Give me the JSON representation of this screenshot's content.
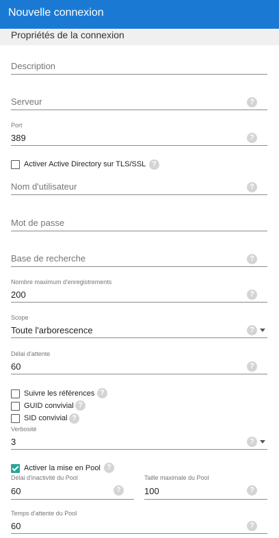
{
  "window": {
    "title": "Nouvelle connexion"
  },
  "section": {
    "title": "Propriétés de la connexion"
  },
  "help_glyph": "?",
  "form": {
    "description": {
      "placeholder": "Description"
    },
    "server": {
      "placeholder": "Serveur"
    },
    "port": {
      "label": "Port",
      "value": "389"
    },
    "ad_tls": {
      "label": "Activer Active Directory sur TLS/SSL",
      "checked": false
    },
    "username": {
      "placeholder": "Nom d'utilisateur"
    },
    "password": {
      "placeholder": "Mot de passe"
    },
    "search_base": {
      "placeholder": "Base de recherche"
    },
    "max_records": {
      "label": "Nombre maximum d'enregistrements",
      "value": "200"
    },
    "scope": {
      "label": "Scope",
      "value": "Toute l'arborescence"
    },
    "timeout": {
      "label": "Délai d'attente",
      "value": "60"
    },
    "follow_refs": {
      "label": "Suivre les références",
      "checked": false
    },
    "guid_friendly": {
      "label": "GUID convivial",
      "checked": false
    },
    "sid_friendly": {
      "label": "SID convivial",
      "checked": false
    },
    "verbosity": {
      "label": "Verbosité",
      "value": "3"
    },
    "pooling": {
      "label": "Activer la mise en Pool",
      "checked": true
    },
    "pool_idle": {
      "label": "Délai d'inactivité du Pool",
      "value": "60"
    },
    "pool_max": {
      "label": "Taille maximale du Pool",
      "value": "100"
    },
    "pool_wait": {
      "label": "Temps d'attente du Pool",
      "value": "60"
    }
  }
}
